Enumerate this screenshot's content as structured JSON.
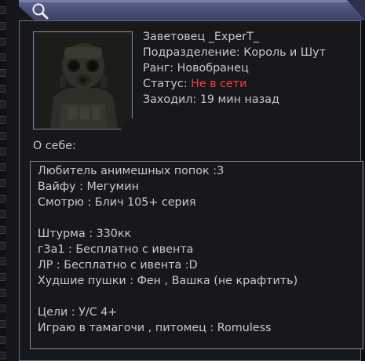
{
  "profile": {
    "name": "Заветовец _ExperT_",
    "division_label": "Подразделение: ",
    "division": "Король и Шут",
    "rank_label": "Ранг: ",
    "rank": "Новобранец",
    "status_label": "Статус: ",
    "status": "Не в сети",
    "last_seen_label": "Заходил: ",
    "last_seen": "19 мин назад",
    "status_color": "#ff3b3b"
  },
  "about": {
    "label": "О себе:",
    "lines": [
      "Любитель анимешных попок :З",
      "Вайфу : Мегумин",
      "Смотрю : Блич 105+ серия",
      "",
      "Штурма : 330кк",
      "г3а1 : Бесплатно с ивента",
      "ЛР : Бесплатно с ивента :D",
      "Худшие пушки : Фен , Вашка (не крафтить)",
      "",
      "Цели : У/С 4+",
      "Играю в тамагочи , питомец : Romuless"
    ]
  },
  "header": {
    "icon": "search-icon",
    "accent": "#4b4f78"
  }
}
